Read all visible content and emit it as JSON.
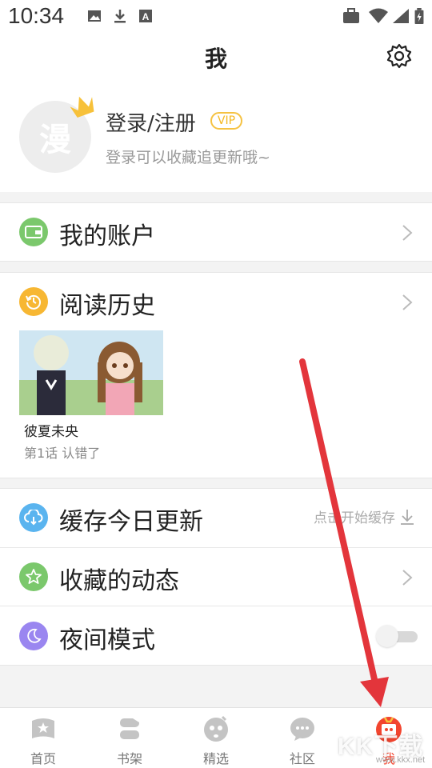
{
  "status_bar": {
    "time": "10:34"
  },
  "header": {
    "title": "我"
  },
  "profile": {
    "avatar_text": "漫",
    "login": "登录/注册",
    "vip": "VIP",
    "subtitle": "登录可以收藏追更新哦~"
  },
  "menu": {
    "account": "我的账户",
    "history": "阅读历史",
    "cache": "缓存今日更新",
    "cache_action": "点击开始缓存",
    "favorites": "收藏的动态",
    "night_mode": "夜间模式",
    "night_mode_on": false
  },
  "history_item": {
    "title": "彼夏未央",
    "subtitle": "第1话 认错了"
  },
  "bottom_nav": {
    "home": "首页",
    "shelf": "书架",
    "featured": "精选",
    "community": "社区",
    "me": "我"
  },
  "watermark": {
    "text": "KK下载",
    "url": "www.kkx.net"
  },
  "colors": {
    "accent": "#f2452f",
    "account_icon": "#7bc86c",
    "history_icon": "#f7b733",
    "cache_icon": "#5ab4ef",
    "favorites_icon": "#7bc86c",
    "night_icon": "#9a86f0",
    "vip": "#f5c242"
  }
}
